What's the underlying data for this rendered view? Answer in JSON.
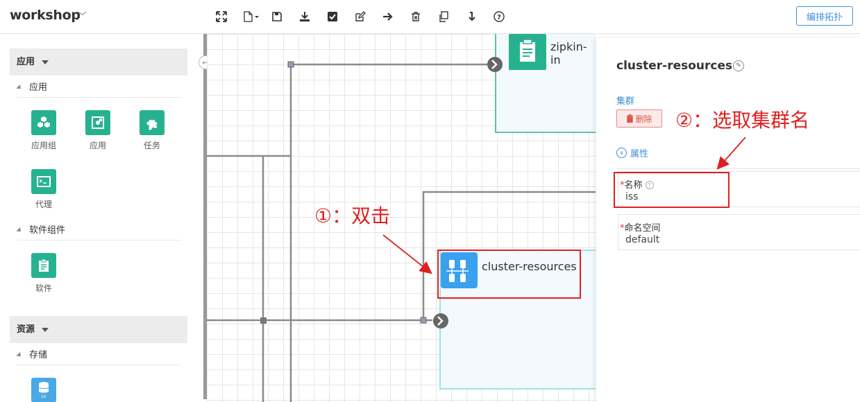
{
  "app": {
    "title": "workshop"
  },
  "toolbar": {
    "edit_topology_label": "编排拓扑",
    "tools": [
      "fullscreen-icon",
      "new-file-icon",
      "save-icon",
      "download-icon",
      "check-icon",
      "edit-icon",
      "arrow-right-icon",
      "trash-icon",
      "copy-icon",
      "import-icon",
      "help-icon"
    ]
  },
  "sidebar": {
    "sections": [
      {
        "title": "应用",
        "groups": [
          {
            "title": "应用",
            "items": [
              "应用组",
              "应用",
              "任务",
              "代理"
            ]
          },
          {
            "title": "软件组件",
            "items": [
              "软件"
            ]
          }
        ]
      },
      {
        "title": "资源",
        "groups": [
          {
            "title": "存储",
            "items": []
          }
        ]
      }
    ],
    "storage_icon_text": "LV"
  },
  "canvas": {
    "nodes": [
      {
        "label": "zipkin-in"
      },
      {
        "label": "cluster-resources"
      }
    ]
  },
  "panel": {
    "title": "cluster-resources",
    "kind": "集群",
    "delete_label": "删除",
    "properties_label": "属性",
    "fields": [
      {
        "label": "名称",
        "value": "iss"
      },
      {
        "label": "命名空间",
        "value": "default"
      }
    ]
  },
  "annotations": {
    "step1": "①：双击",
    "step2": "②：选取集群名"
  },
  "colors": {
    "accent": "#3b8fd9",
    "palette_green": "#27b28f",
    "annotation_red": "#e02020"
  }
}
